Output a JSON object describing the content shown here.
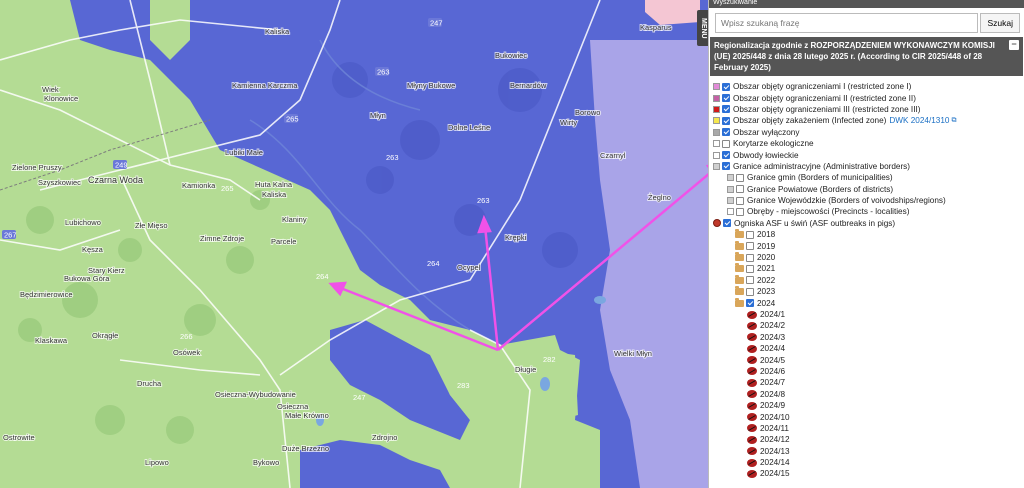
{
  "map": {
    "places": [
      {
        "id": "kaliska",
        "text": "Kaliska"
      },
      {
        "id": "kamienna-karczma",
        "text": "Kamienna Karczma"
      },
      {
        "id": "wiek",
        "text": "Wiek"
      },
      {
        "id": "klonowice",
        "text": "Klonowice"
      },
      {
        "id": "mlyn",
        "text": "Młyn"
      },
      {
        "id": "mlyny-bukowe",
        "text": "Młyny Bukowe"
      },
      {
        "id": "bukowiec",
        "text": "Bukowiec"
      },
      {
        "id": "bernardow",
        "text": "Bernardów"
      },
      {
        "id": "dolne-les",
        "text": "Dolne Leśne"
      },
      {
        "id": "luby-male",
        "text": "Lubiki Małe"
      },
      {
        "id": "czarna-woda",
        "text": "Czarna Woda"
      },
      {
        "id": "szyszkowiec",
        "text": "Szyszkowiec"
      },
      {
        "id": "zielone-pruszy",
        "text": "Zielone Pruszy"
      },
      {
        "id": "kamionka",
        "text": "Kamionka"
      },
      {
        "id": "huta-kalna",
        "text": "Huta Kalna"
      },
      {
        "id": "kaliska-2",
        "text": "Kaliska"
      },
      {
        "id": "klaniny",
        "text": "Klaniny"
      },
      {
        "id": "zimne-zdroje",
        "text": "Zimne Zdroje"
      },
      {
        "id": "parcele",
        "text": "Parcele"
      },
      {
        "id": "zle-mieso",
        "text": "Złe Mięso"
      },
      {
        "id": "lubichowo",
        "text": "Lubichowo"
      },
      {
        "id": "keszyca",
        "text": "Kęsza"
      },
      {
        "id": "bukowa-gora",
        "text": "Bukowa Góra"
      },
      {
        "id": "stary-kierz",
        "text": "Stary Kierz"
      },
      {
        "id": "bedzimierowice",
        "text": "Będzimierowice"
      },
      {
        "id": "klaskawa",
        "text": "Klaskawa"
      },
      {
        "id": "osowek",
        "text": "Osówek"
      },
      {
        "id": "okrogle",
        "text": "Okrągłe"
      },
      {
        "id": "druchnia",
        "text": "Drucha"
      },
      {
        "id": "osieczna-wybudowanie",
        "text": "Osieczna-Wybudowanie"
      },
      {
        "id": "osieczna",
        "text": "Osieczna"
      },
      {
        "id": "male-krowno",
        "text": "Małe Krówno"
      },
      {
        "id": "ostrowite",
        "text": "Ostrowite"
      },
      {
        "id": "lipowo",
        "text": "Lipowo"
      },
      {
        "id": "dlugie",
        "text": "Długie"
      },
      {
        "id": "dube-brzezno",
        "text": "Duże Brzezno"
      },
      {
        "id": "bykowo",
        "text": "Bykowo"
      },
      {
        "id": "zdrojno",
        "text": "Zdrojno"
      },
      {
        "id": "krepki",
        "text": "Krępki"
      },
      {
        "id": "ocypel",
        "text": "Ocypel"
      },
      {
        "id": "borowo",
        "text": "Borowo"
      },
      {
        "id": "czarnyl",
        "text": "Czarnyl"
      },
      {
        "id": "zeglno",
        "text": "Żeglno"
      },
      {
        "id": "wielki-mlyn",
        "text": "Wielki Młyn"
      },
      {
        "id": "kasparus",
        "text": "Kasparus"
      },
      {
        "id": "wirty",
        "text": "Wirty"
      }
    ],
    "road_numbers": [
      "247",
      "263",
      "265",
      "249",
      "267",
      "264",
      "265",
      "266",
      "263",
      "263",
      "283",
      "283",
      "282",
      "247"
    ],
    "zone_labels": [
      {
        "id": "z263a",
        "text": "263"
      },
      {
        "id": "z263b",
        "text": "263"
      },
      {
        "id": "z264a",
        "text": "264"
      },
      {
        "id": "z264b",
        "text": "264"
      },
      {
        "id": "z265",
        "text": "265"
      },
      {
        "id": "z283",
        "text": "283"
      },
      {
        "id": "z282",
        "text": "282"
      },
      {
        "id": "z266",
        "text": "266"
      },
      {
        "id": "z247",
        "text": "247"
      }
    ],
    "colors": {
      "restricted_3": "#5867d4",
      "restricted_2": "#a9a4e8",
      "restricted_1": "#f4c6d3",
      "free": "#b4dc94",
      "arrow": "#f052e8"
    }
  },
  "menu_tab": {
    "label": "MENU"
  },
  "panel": {
    "header_text": "Wyszukiwanie",
    "search": {
      "placeholder": "Wpisz szukaną frazę",
      "button_label": "Szukaj"
    },
    "section_title": "Regionalizacja zgodnie z ROZPORZĄDZENIEM WYKONAWCZYM KOMISJI (UE) 2025/448 z dnia 28 lutego 2025 r. (According to CIR 2025/448 of 28 February 2025)",
    "collapse_symbol": "−",
    "layers": [
      {
        "label": "Obszar objęty ograniczeniami I (restricted zone I)",
        "swatch": "#e28bd8",
        "checked": true,
        "indent": 0
      },
      {
        "label": "Obszar objęty ograniczeniami II (restricted zone II)",
        "swatch": "#c460a5",
        "checked": true,
        "indent": 0
      },
      {
        "label": "Obszar objęty ograniczeniami III (restricted zone III)",
        "swatch": "#d21a1a",
        "checked": true,
        "indent": 0
      },
      {
        "label": "Obszar objęty zakażeniem (Infected zone)",
        "swatch": "#f6e84d",
        "checked": true,
        "indent": 0,
        "link": "DWK 2024/1310"
      },
      {
        "label": "Obszar wyłączony",
        "swatch": "#a9a9a9",
        "checked": true,
        "indent": 0
      },
      {
        "label": "Korytarze ekologiczne",
        "swatch": "#ffffff",
        "checked": false,
        "indent": 0
      },
      {
        "label": "Obwody łowieckie",
        "swatch": "#ffffff",
        "checked": true,
        "indent": 0
      },
      {
        "label": "Granice administracyjne (Administrative borders)",
        "swatch": "#d0d0d0",
        "checked": true,
        "indent": 0
      },
      {
        "label": "Granice gmin (Borders of municipalities)",
        "swatch": "#d0d0d0",
        "checked": false,
        "indent": 1
      },
      {
        "label": "Granice Powiatowe (Borders of districts)",
        "swatch": "#d0d0d0",
        "checked": false,
        "indent": 1
      },
      {
        "label": "Granice Wojewódzkie (Borders of voivodships/regions)",
        "swatch": "#d0d0d0",
        "checked": false,
        "indent": 1
      },
      {
        "label": "Obręby - miejscowości (Precincts - localities)",
        "swatch": "#ffffff",
        "checked": false,
        "indent": 1
      },
      {
        "label": "Ogniska ASF u świń (ASF outbreaks in pigs)",
        "type": "dot",
        "checked": true,
        "indent": 0
      }
    ],
    "years": [
      {
        "label": "2018",
        "checked": false
      },
      {
        "label": "2019",
        "checked": false
      },
      {
        "label": "2020",
        "checked": false
      },
      {
        "label": "2021",
        "checked": false
      },
      {
        "label": "2022",
        "checked": false
      },
      {
        "label": "2023",
        "checked": false
      },
      {
        "label": "2024",
        "checked": true
      }
    ],
    "sublayers_2024": [
      "2024/1",
      "2024/2",
      "2024/3",
      "2024/4",
      "2024/5",
      "2024/6",
      "2024/7",
      "2024/8",
      "2024/9",
      "2024/10",
      "2024/11",
      "2024/12",
      "2024/13",
      "2024/14",
      "2024/15"
    ]
  }
}
